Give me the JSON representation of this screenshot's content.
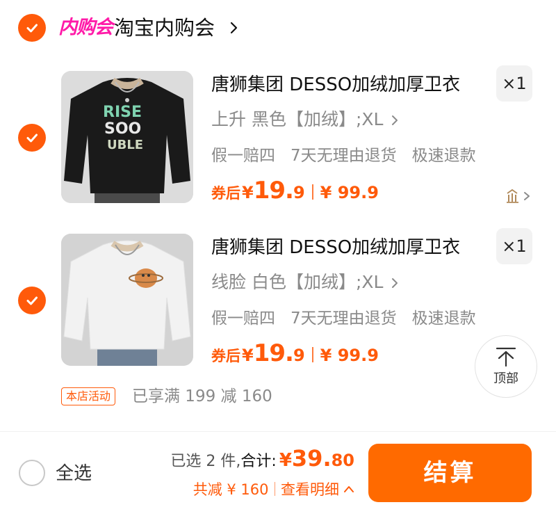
{
  "store": {
    "badge": "内购会",
    "name": "淘宝内购会"
  },
  "items": [
    {
      "title": "唐狮集团 DESSO加绒加厚卫衣",
      "quantity": "×1",
      "sku": "上升 黑色【加绒】;XL",
      "services": [
        "假一赔四",
        "7天无理由退货",
        "极速退款"
      ],
      "price_label": "券后",
      "price_yen": "¥",
      "price_int": "19.",
      "price_dec": "9",
      "original_price": "¥ 99.9",
      "shirt_color": "#1a1a1a",
      "print_text": [
        "RISE",
        "SOO",
        "UBLE"
      ]
    },
    {
      "title": "唐狮集团 DESSO加绒加厚卫衣",
      "quantity": "×1",
      "sku": "线脸 白色【加绒】;XL",
      "services": [
        "假一赔四",
        "7天无理由退货",
        "极速退款"
      ],
      "price_label": "券后",
      "price_yen": "¥",
      "price_int": "19.",
      "price_dec": "9",
      "original_price": "¥ 99.9",
      "shirt_color": "#f2f2f2"
    }
  ],
  "back_to_top": "顶部",
  "promotion": {
    "tag": "本店活动",
    "text": "已享满 199 减 160"
  },
  "footer": {
    "select_all": "全选",
    "selected_count": "已选 2 件,",
    "total_label": "合计:",
    "total_yen": "¥",
    "total_int": "39.",
    "total_dec": "80",
    "discount": "共减 ¥ 160",
    "details": "查看明细",
    "checkout": "结算"
  },
  "colors": {
    "accent": "#ff5a0a",
    "checkout": "#ff6a00",
    "badge_pink": "#ff1aa8",
    "muted_text": "#8a8a8a"
  }
}
